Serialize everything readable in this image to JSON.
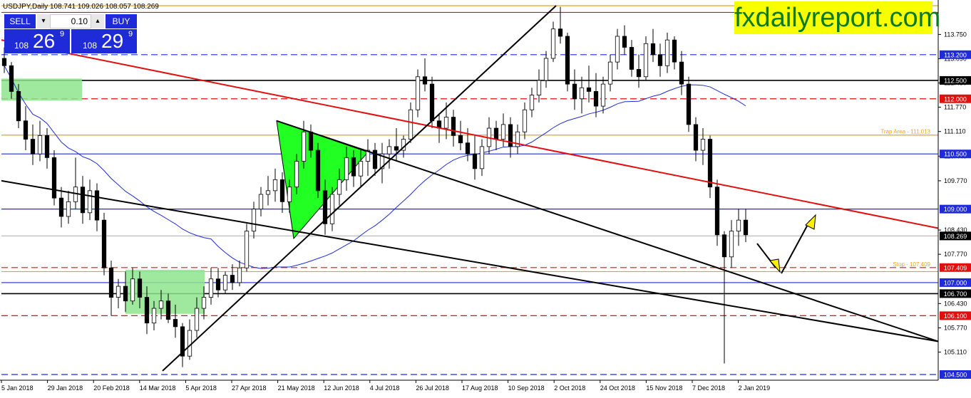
{
  "header": {
    "symbol_line": "USDJPY,Daily  108.741 109.026 108.057 108.269"
  },
  "trade_panel": {
    "sell_label": "SELL",
    "buy_label": "BUY",
    "lot": "0.10",
    "sell_prefix": "108",
    "sell_big": "26",
    "sell_sup": "9",
    "buy_prefix": "108",
    "buy_big": "29",
    "buy_sup": "9"
  },
  "brand": {
    "text": "fxdailyreport.com",
    "bg": "#f7ff00",
    "fg": "#0b7a1f"
  },
  "chart_data": {
    "type": "candlestick",
    "symbol": "USDJPY",
    "timeframe": "Daily",
    "ylim": [
      104.3,
      114.6
    ],
    "grid": false,
    "y_ticks": [
      "113.750",
      "113.090",
      "112.430",
      "111.770",
      "111.110",
      "110.440",
      "109.770",
      "108.430",
      "107.770",
      "106.430",
      "105.770",
      "105.110"
    ],
    "x_ticks": [
      "5 Jan 2018",
      "29 Jan 2018",
      "20 Feb 2018",
      "14 Mar 2018",
      "5 Apr 2018",
      "27 Apr 2018",
      "21 May 2018",
      "12 Jun 2018",
      "4 Jul 2018",
      "26 Jul 2018",
      "17 Aug 2018",
      "10 Sep 2018",
      "2 Oct 2018",
      "24 Oct 2018",
      "15 Nov 2018",
      "7 Dec 2018",
      "2 Jan 2019"
    ],
    "price_labels": [
      {
        "text": "113.200",
        "value": 113.2,
        "bg": "#1f2bd8"
      },
      {
        "text": "112.500",
        "value": 112.5,
        "bg": "#000000"
      },
      {
        "text": "112.000",
        "value": 112.0,
        "bg": "#e01010"
      },
      {
        "text": "110.500",
        "value": 110.5,
        "bg": "#1f2bd8"
      },
      {
        "text": "109.000",
        "value": 109.0,
        "bg": "#1f2bd8"
      },
      {
        "text": "108.269",
        "value": 108.269,
        "bg": "#000000"
      },
      {
        "text": "107.409",
        "value": 107.409,
        "bg": "#e01010"
      },
      {
        "text": "107.000",
        "value": 107.0,
        "bg": "#1f2bd8"
      },
      {
        "text": "106.700",
        "value": 106.7,
        "bg": "#000000"
      },
      {
        "text": "106.100",
        "value": 106.1,
        "bg": "#e01010"
      },
      {
        "text": "104.500",
        "value": 104.5,
        "bg": "#1f2bd8"
      }
    ],
    "annotations": [
      {
        "text": "Trap Area - 111.013",
        "value": 111.013,
        "color": "#e8a317"
      },
      {
        "text": "Stop - 107.409",
        "value": 107.409,
        "color": "#e8a317"
      }
    ],
    "horizontal_lines": [
      {
        "value": 114.6,
        "color": "#e8a317",
        "style": "solid"
      },
      {
        "value": 114.35,
        "color": "#e01010",
        "style": "solid"
      },
      {
        "value": 113.2,
        "color": "#1f2bd8",
        "style": "dashed"
      },
      {
        "value": 112.5,
        "color": "#000000",
        "style": "solid"
      },
      {
        "value": 112.0,
        "color": "#e01010",
        "style": "dashed"
      },
      {
        "value": 111.013,
        "color": "#e8a317",
        "style": "solid"
      },
      {
        "value": 110.5,
        "color": "#1f2bd8",
        "style": "solid"
      },
      {
        "value": 109.0,
        "color": "#1f2bd8",
        "style": "solid"
      },
      {
        "value": 108.269,
        "color": "#bbbbbb",
        "style": "solid"
      },
      {
        "value": 107.409,
        "color": "#e01010",
        "style": "dashed"
      },
      {
        "value": 107.3,
        "color": "#e8a317",
        "style": "solid"
      },
      {
        "value": 107.0,
        "color": "#1f2bd8",
        "style": "solid"
      },
      {
        "value": 106.7,
        "color": "#000000",
        "style": "solid"
      },
      {
        "value": 106.1,
        "color": "#e01010",
        "style": "dashed"
      },
      {
        "value": 104.5,
        "color": "#1f2bd8",
        "style": "dashed"
      }
    ],
    "colors": {
      "trend_red": "#e01010",
      "trend_black": "#000000",
      "zone_green": "#8de58d",
      "triangle_green": "#22ff22",
      "ma_blue": "#1f2bd8",
      "arrow_yellow": "#ffee00"
    },
    "candles": [
      {
        "o": 113.1,
        "h": 113.4,
        "l": 112.7,
        "c": 112.9
      },
      {
        "o": 112.9,
        "h": 113.0,
        "l": 112.0,
        "c": 112.2
      },
      {
        "o": 112.2,
        "h": 112.4,
        "l": 111.2,
        "c": 111.4
      },
      {
        "o": 111.4,
        "h": 111.8,
        "l": 110.6,
        "c": 110.9
      },
      {
        "o": 110.9,
        "h": 111.3,
        "l": 110.2,
        "c": 110.5
      },
      {
        "o": 110.5,
        "h": 111.4,
        "l": 110.3,
        "c": 111.0
      },
      {
        "o": 111.0,
        "h": 111.2,
        "l": 110.1,
        "c": 110.4
      },
      {
        "o": 110.4,
        "h": 110.6,
        "l": 109.1,
        "c": 109.3
      },
      {
        "o": 109.3,
        "h": 109.6,
        "l": 108.5,
        "c": 108.8
      },
      {
        "o": 108.8,
        "h": 109.5,
        "l": 108.6,
        "c": 109.2
      },
      {
        "o": 109.2,
        "h": 110.4,
        "l": 109.0,
        "c": 109.6
      },
      {
        "o": 109.6,
        "h": 109.9,
        "l": 108.6,
        "c": 108.9
      },
      {
        "o": 108.9,
        "h": 109.8,
        "l": 108.7,
        "c": 109.5
      },
      {
        "o": 109.5,
        "h": 109.7,
        "l": 108.4,
        "c": 108.7
      },
      {
        "o": 108.7,
        "h": 108.9,
        "l": 107.2,
        "c": 107.4
      },
      {
        "o": 107.4,
        "h": 107.6,
        "l": 106.1,
        "c": 106.6
      },
      {
        "o": 106.6,
        "h": 107.1,
        "l": 106.3,
        "c": 106.9
      },
      {
        "o": 106.9,
        "h": 107.3,
        "l": 106.2,
        "c": 106.5
      },
      {
        "o": 106.5,
        "h": 107.4,
        "l": 106.4,
        "c": 107.1
      },
      {
        "o": 107.1,
        "h": 107.3,
        "l": 106.3,
        "c": 106.6
      },
      {
        "o": 106.6,
        "h": 106.9,
        "l": 105.6,
        "c": 105.9
      },
      {
        "o": 105.9,
        "h": 106.5,
        "l": 105.7,
        "c": 106.3
      },
      {
        "o": 106.3,
        "h": 106.8,
        "l": 106.0,
        "c": 106.5
      },
      {
        "o": 106.5,
        "h": 106.7,
        "l": 105.9,
        "c": 106.0
      },
      {
        "o": 106.0,
        "h": 106.4,
        "l": 105.5,
        "c": 105.8
      },
      {
        "o": 105.8,
        "h": 105.9,
        "l": 104.7,
        "c": 105.0
      },
      {
        "o": 105.0,
        "h": 106.0,
        "l": 104.9,
        "c": 105.7
      },
      {
        "o": 105.7,
        "h": 106.6,
        "l": 105.5,
        "c": 106.3
      },
      {
        "o": 106.3,
        "h": 106.9,
        "l": 106.0,
        "c": 106.6
      },
      {
        "o": 106.6,
        "h": 107.4,
        "l": 106.4,
        "c": 107.1
      },
      {
        "o": 107.1,
        "h": 107.4,
        "l": 106.6,
        "c": 106.8
      },
      {
        "o": 106.8,
        "h": 107.3,
        "l": 106.7,
        "c": 107.2
      },
      {
        "o": 107.2,
        "h": 107.5,
        "l": 106.8,
        "c": 107.0
      },
      {
        "o": 107.0,
        "h": 107.6,
        "l": 106.9,
        "c": 107.4
      },
      {
        "o": 107.4,
        "h": 108.6,
        "l": 107.3,
        "c": 108.4
      },
      {
        "o": 108.4,
        "h": 109.2,
        "l": 108.2,
        "c": 109.0
      },
      {
        "o": 109.0,
        "h": 109.6,
        "l": 108.8,
        "c": 109.4
      },
      {
        "o": 109.4,
        "h": 109.9,
        "l": 109.1,
        "c": 109.5
      },
      {
        "o": 109.5,
        "h": 110.1,
        "l": 109.2,
        "c": 109.8
      },
      {
        "o": 109.8,
        "h": 110.0,
        "l": 108.9,
        "c": 109.2
      },
      {
        "o": 109.2,
        "h": 109.8,
        "l": 108.9,
        "c": 109.6
      },
      {
        "o": 109.6,
        "h": 110.5,
        "l": 109.4,
        "c": 110.3
      },
      {
        "o": 110.3,
        "h": 111.4,
        "l": 110.1,
        "c": 111.1
      },
      {
        "o": 111.1,
        "h": 111.3,
        "l": 110.4,
        "c": 110.6
      },
      {
        "o": 110.6,
        "h": 110.8,
        "l": 109.3,
        "c": 109.5
      },
      {
        "o": 109.5,
        "h": 109.8,
        "l": 108.3,
        "c": 108.6
      },
      {
        "o": 108.6,
        "h": 109.6,
        "l": 108.4,
        "c": 109.4
      },
      {
        "o": 109.4,
        "h": 110.1,
        "l": 109.1,
        "c": 109.8
      },
      {
        "o": 109.8,
        "h": 110.7,
        "l": 109.5,
        "c": 110.4
      },
      {
        "o": 110.4,
        "h": 110.6,
        "l": 109.6,
        "c": 109.9
      },
      {
        "o": 109.9,
        "h": 110.6,
        "l": 109.6,
        "c": 110.3
      },
      {
        "o": 110.3,
        "h": 110.9,
        "l": 109.9,
        "c": 110.6
      },
      {
        "o": 110.6,
        "h": 110.8,
        "l": 109.9,
        "c": 110.1
      },
      {
        "o": 110.1,
        "h": 110.8,
        "l": 109.7,
        "c": 110.5
      },
      {
        "o": 110.5,
        "h": 110.9,
        "l": 110.1,
        "c": 110.7
      },
      {
        "o": 110.7,
        "h": 111.2,
        "l": 110.3,
        "c": 110.6
      },
      {
        "o": 110.6,
        "h": 111.0,
        "l": 110.4,
        "c": 110.9
      },
      {
        "o": 110.9,
        "h": 111.9,
        "l": 110.8,
        "c": 111.7
      },
      {
        "o": 111.7,
        "h": 112.8,
        "l": 111.5,
        "c": 112.6
      },
      {
        "o": 112.6,
        "h": 113.1,
        "l": 112.2,
        "c": 112.4
      },
      {
        "o": 112.4,
        "h": 112.6,
        "l": 111.2,
        "c": 111.4
      },
      {
        "o": 111.4,
        "h": 111.6,
        "l": 110.8,
        "c": 111.2
      },
      {
        "o": 111.2,
        "h": 111.9,
        "l": 110.9,
        "c": 111.5
      },
      {
        "o": 111.5,
        "h": 111.7,
        "l": 110.7,
        "c": 111.0
      },
      {
        "o": 111.0,
        "h": 111.4,
        "l": 110.6,
        "c": 110.8
      },
      {
        "o": 110.8,
        "h": 111.2,
        "l": 110.3,
        "c": 110.5
      },
      {
        "o": 110.5,
        "h": 111.0,
        "l": 109.8,
        "c": 110.1
      },
      {
        "o": 110.1,
        "h": 110.9,
        "l": 109.9,
        "c": 110.7
      },
      {
        "o": 110.7,
        "h": 111.5,
        "l": 110.5,
        "c": 111.2
      },
      {
        "o": 111.2,
        "h": 111.4,
        "l": 110.6,
        "c": 110.9
      },
      {
        "o": 110.9,
        "h": 111.6,
        "l": 110.7,
        "c": 111.3
      },
      {
        "o": 111.3,
        "h": 111.5,
        "l": 110.4,
        "c": 110.7
      },
      {
        "o": 110.7,
        "h": 111.3,
        "l": 110.5,
        "c": 111.1
      },
      {
        "o": 111.1,
        "h": 111.9,
        "l": 110.9,
        "c": 111.7
      },
      {
        "o": 111.7,
        "h": 112.3,
        "l": 111.5,
        "c": 112.1
      },
      {
        "o": 112.1,
        "h": 112.8,
        "l": 111.9,
        "c": 112.5
      },
      {
        "o": 112.5,
        "h": 113.3,
        "l": 112.3,
        "c": 113.1
      },
      {
        "o": 113.1,
        "h": 114.1,
        "l": 113.0,
        "c": 113.9
      },
      {
        "o": 113.9,
        "h": 114.5,
        "l": 113.5,
        "c": 113.7
      },
      {
        "o": 113.7,
        "h": 113.8,
        "l": 112.2,
        "c": 112.4
      },
      {
        "o": 112.4,
        "h": 112.8,
        "l": 111.7,
        "c": 112.0
      },
      {
        "o": 112.0,
        "h": 112.6,
        "l": 111.6,
        "c": 112.3
      },
      {
        "o": 112.3,
        "h": 112.9,
        "l": 111.9,
        "c": 112.2
      },
      {
        "o": 112.2,
        "h": 112.7,
        "l": 111.5,
        "c": 111.8
      },
      {
        "o": 111.8,
        "h": 112.6,
        "l": 111.6,
        "c": 112.4
      },
      {
        "o": 112.4,
        "h": 113.2,
        "l": 112.2,
        "c": 113.0
      },
      {
        "o": 113.0,
        "h": 113.9,
        "l": 112.8,
        "c": 113.7
      },
      {
        "o": 113.7,
        "h": 114.0,
        "l": 113.2,
        "c": 113.4
      },
      {
        "o": 113.4,
        "h": 113.6,
        "l": 112.6,
        "c": 112.8
      },
      {
        "o": 112.8,
        "h": 113.2,
        "l": 112.3,
        "c": 112.6
      },
      {
        "o": 112.6,
        "h": 113.7,
        "l": 112.5,
        "c": 113.5
      },
      {
        "o": 113.5,
        "h": 113.9,
        "l": 113.0,
        "c": 113.2
      },
      {
        "o": 113.2,
        "h": 113.5,
        "l": 112.6,
        "c": 112.9
      },
      {
        "o": 112.9,
        "h": 113.8,
        "l": 112.7,
        "c": 113.6
      },
      {
        "o": 113.6,
        "h": 113.7,
        "l": 112.8,
        "c": 113.0
      },
      {
        "o": 113.0,
        "h": 113.3,
        "l": 112.1,
        "c": 112.4
      },
      {
        "o": 112.4,
        "h": 112.6,
        "l": 111.1,
        "c": 111.3
      },
      {
        "o": 111.3,
        "h": 111.5,
        "l": 110.3,
        "c": 110.6
      },
      {
        "o": 110.6,
        "h": 111.2,
        "l": 110.2,
        "c": 110.9
      },
      {
        "o": 110.9,
        "h": 111.0,
        "l": 109.3,
        "c": 109.6
      },
      {
        "o": 109.6,
        "h": 109.8,
        "l": 108.0,
        "c": 108.3
      },
      {
        "o": 108.3,
        "h": 108.4,
        "l": 104.8,
        "c": 107.7
      },
      {
        "o": 107.7,
        "h": 108.7,
        "l": 107.4,
        "c": 108.4
      },
      {
        "o": 108.4,
        "h": 109.0,
        "l": 108.0,
        "c": 108.7
      },
      {
        "o": 108.7,
        "h": 109.0,
        "l": 108.1,
        "c": 108.3
      }
    ]
  }
}
